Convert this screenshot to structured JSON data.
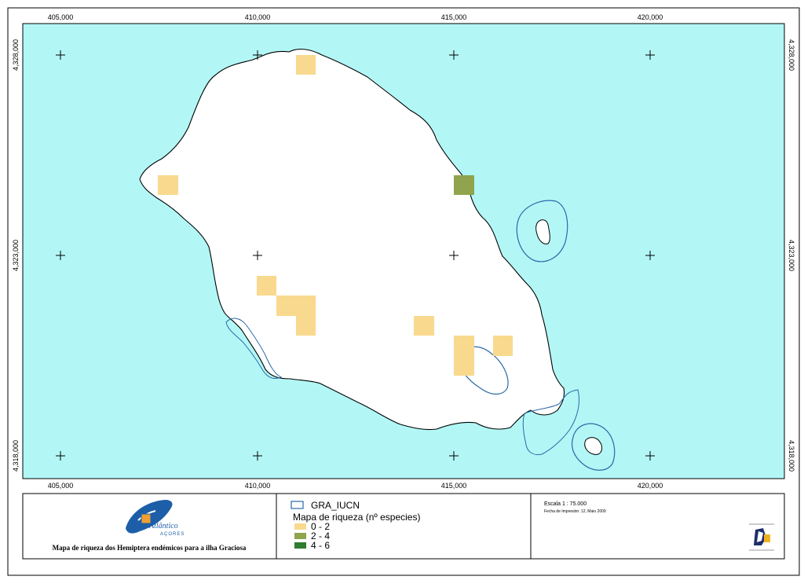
{
  "map": {
    "x_ticks": [
      "405,000",
      "410,000",
      "415,000",
      "420,000"
    ],
    "y_ticks": [
      "4,328,000",
      "4,323,000",
      "4,318,000"
    ],
    "colors": {
      "sea": "#b2f7f6",
      "land": "#ffffff",
      "coast": "#000000",
      "iucn_outline": "#2a6aa8",
      "class_0_2": "#f8d98e",
      "class_2_4": "#8fa44c",
      "class_4_6": "#2e7d2e"
    },
    "richness_cells": [
      {
        "class": "0 - 2"
      },
      {
        "class": "0 - 2"
      },
      {
        "class": "2 - 4"
      },
      {
        "class": "0 - 2"
      },
      {
        "class": "0 - 2"
      },
      {
        "class": "0 - 2"
      },
      {
        "class": "0 - 2"
      },
      {
        "class": "0 - 2"
      },
      {
        "class": "0 - 2"
      },
      {
        "class": "0 - 2"
      },
      {
        "class": "0 - 2"
      }
    ]
  },
  "footer": {
    "logo": {
      "text": "Atlântico",
      "sub": "AÇORES"
    },
    "caption": "Mapa de riqueza dos Hemiptera endémicos para a ilha Graciosa"
  },
  "legend": {
    "layer_label": "GRA_IUCN",
    "title": "Mapa de riqueza (nº especies)",
    "classes": [
      {
        "label": "0 - 2",
        "color": "#f8d98e"
      },
      {
        "label": "2 - 4",
        "color": "#8fa44c"
      },
      {
        "label": "4 - 6",
        "color": "#2e7d2e"
      }
    ]
  },
  "scale": {
    "label": "Escala 1 : 75.000",
    "print_date": "Fecha de Impresión: 12, Maio 2009"
  }
}
